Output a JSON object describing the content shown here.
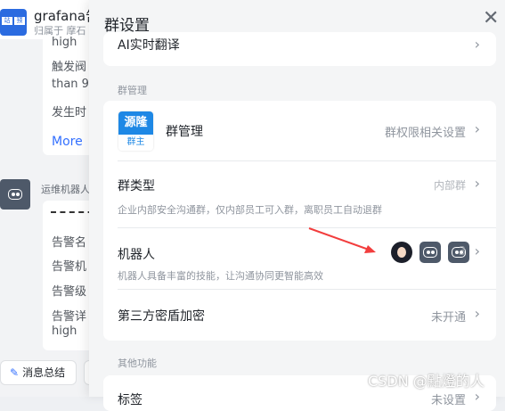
{
  "chat": {
    "group_name": "grafana告",
    "group_sub": "归属于 摩石",
    "avatar_chars": [
      "站",
      "预"
    ],
    "message1_lines": [
      "high",
      "触发阀",
      "than 9",
      "发生时"
    ],
    "more_label": "More",
    "bot_name": "运维机器人",
    "message2_lines": [
      "告警名",
      "告警机",
      "告警级",
      "告警详",
      "high"
    ],
    "summary_button": "消息总结"
  },
  "panel": {
    "title": "群设置",
    "top_row_label": "AI实时翻译",
    "section_manage": "群管理",
    "manage_label": "群管理",
    "manage_value": "群权限相关设置",
    "logo_top": "源隆",
    "logo_bottom": "群主",
    "type_label": "群类型",
    "type_value": "内部群",
    "type_desc": "企业内部安全沟通群，仅内部员工可入群，离职员工自动退群",
    "robot_label": "机器人",
    "robot_count": "3",
    "robot_desc": "机器人具备丰富的技能，让沟通协同更智能高效",
    "third_label": "第三方密盾加密",
    "third_value": "未开通",
    "section_other": "其他功能",
    "bottom_label": "标签",
    "bottom_value": "未设置"
  },
  "watermark": "CSDN @點燈的人",
  "colors": {
    "accent": "#3370ff",
    "arrow": "#f23d3d",
    "logo": "#1e88e5"
  }
}
